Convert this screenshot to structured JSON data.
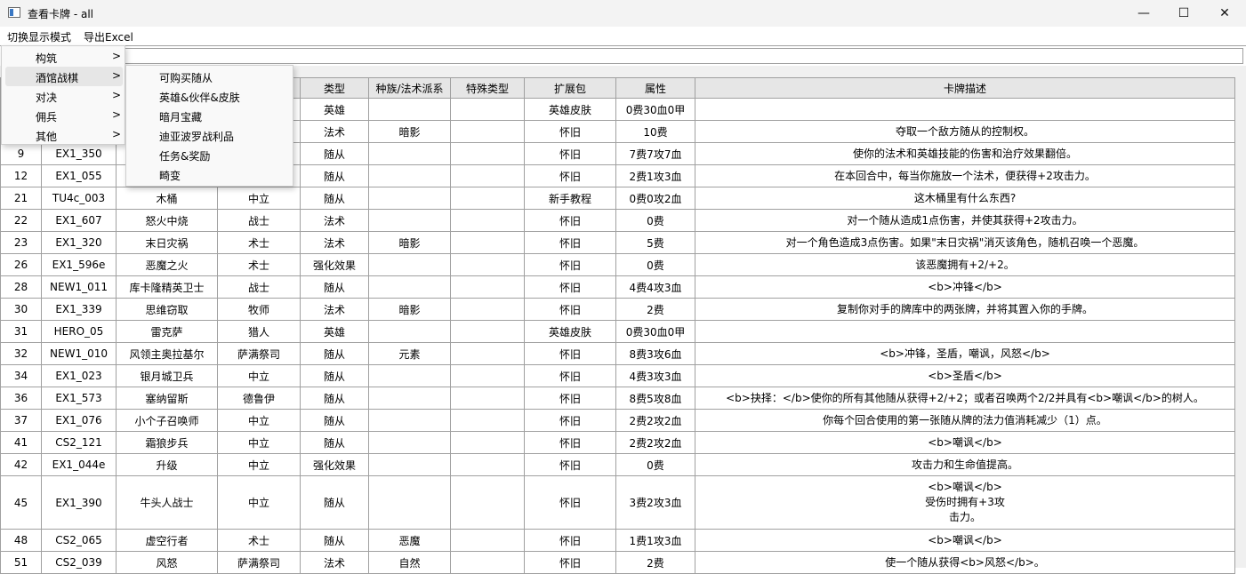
{
  "window": {
    "title": "查看卡牌 - all",
    "controls": {
      "minimize": "—",
      "maximize": "☐",
      "close": "✕"
    }
  },
  "menubar": [
    "切换显示模式",
    "导出Excel"
  ],
  "filter": {
    "value": "",
    "placeholder": ""
  },
  "menu": {
    "items": [
      {
        "label": "构筑",
        "arrow": ">"
      },
      {
        "label": "酒馆战棋",
        "arrow": ">"
      },
      {
        "label": "对决",
        "arrow": ">"
      },
      {
        "label": "佣兵",
        "arrow": ">"
      },
      {
        "label": "其他",
        "arrow": ">"
      }
    ],
    "active_index": 1,
    "submenu": [
      "可购买随从",
      "英雄&伙伴&皮肤",
      "暗月宝藏",
      "迪亚波罗战利品",
      "任务&奖励",
      "畸变"
    ]
  },
  "table": {
    "columns": [
      "",
      "",
      "",
      "",
      "类型",
      "种族/法术派系",
      "特殊类型",
      "扩展包",
      "属性",
      "卡牌描述"
    ],
    "rows": [
      [
        "",
        "",
        "",
        "",
        "英雄",
        "",
        "",
        "英雄皮肤",
        "0费30血0甲",
        ""
      ],
      [
        "",
        "",
        "",
        "",
        "法术",
        "暗影",
        "",
        "怀旧",
        "10费",
        "夺取一个敌方随从的控制权。"
      ],
      [
        "9",
        "EX1_350",
        "",
        "",
        "随从",
        "",
        "",
        "怀旧",
        "7费7攻7血",
        "使你的法术和英雄技能的伤害和治疗效果翻倍。"
      ],
      [
        "12",
        "EX1_055",
        "",
        "",
        "随从",
        "",
        "",
        "怀旧",
        "2费1攻3血",
        "在本回合中，每当你施放一个法术，便获得+2攻击力。"
      ],
      [
        "21",
        "TU4c_003",
        "木桶",
        "中立",
        "随从",
        "",
        "",
        "新手教程",
        "0费0攻2血",
        "这木桶里有什么东西?"
      ],
      [
        "22",
        "EX1_607",
        "怒火中烧",
        "战士",
        "法术",
        "",
        "",
        "怀旧",
        "0费",
        "对一个随从造成1点伤害，并使其获得+2攻击力。"
      ],
      [
        "23",
        "EX1_320",
        "末日灾祸",
        "术士",
        "法术",
        "暗影",
        "",
        "怀旧",
        "5费",
        "对一个角色造成3点伤害。如果\"末日灾祸\"消灭该角色，随机召唤一个恶魔。"
      ],
      [
        "26",
        "EX1_596e",
        "恶魔之火",
        "术士",
        "强化效果",
        "",
        "",
        "怀旧",
        "0费",
        "该恶魔拥有+2/+2。"
      ],
      [
        "28",
        "NEW1_011",
        "库卡隆精英卫士",
        "战士",
        "随从",
        "",
        "",
        "怀旧",
        "4费4攻3血",
        "<b>冲锋</b>"
      ],
      [
        "30",
        "EX1_339",
        "思维窃取",
        "牧师",
        "法术",
        "暗影",
        "",
        "怀旧",
        "2费",
        "复制你对手的牌库中的两张牌，并将其置入你的手牌。"
      ],
      [
        "31",
        "HERO_05",
        "雷克萨",
        "猎人",
        "英雄",
        "",
        "",
        "英雄皮肤",
        "0费30血0甲",
        ""
      ],
      [
        "32",
        "NEW1_010",
        "风领主奥拉基尔",
        "萨满祭司",
        "随从",
        "元素",
        "",
        "怀旧",
        "8费3攻6血",
        "<b>冲锋，圣盾，嘲讽，风怒</b>"
      ],
      [
        "34",
        "EX1_023",
        "银月城卫兵",
        "中立",
        "随从",
        "",
        "",
        "怀旧",
        "4费3攻3血",
        "<b>圣盾</b>"
      ],
      [
        "36",
        "EX1_573",
        "塞纳留斯",
        "德鲁伊",
        "随从",
        "",
        "",
        "怀旧",
        "8费5攻8血",
        "<b>抉择：</b>使你的所有其他随从获得+2/+2；或者召唤两个2/2并具有<b>嘲讽</b>的树人。"
      ],
      [
        "37",
        "EX1_076",
        "小个子召唤师",
        "中立",
        "随从",
        "",
        "",
        "怀旧",
        "2费2攻2血",
        "你每个回合使用的第一张随从牌的法力值消耗减少（1）点。"
      ],
      [
        "41",
        "CS2_121",
        "霜狼步兵",
        "中立",
        "随从",
        "",
        "",
        "怀旧",
        "2费2攻2血",
        "<b>嘲讽</b>"
      ],
      [
        "42",
        "EX1_044e",
        "升级",
        "中立",
        "强化效果",
        "",
        "",
        "怀旧",
        "0费",
        "攻击力和生命值提高。"
      ],
      [
        "45",
        "EX1_390",
        "牛头人战士",
        "中立",
        "随从",
        "",
        "",
        "怀旧",
        "3费2攻3血",
        "<b>嘲讽</b>\n受伤时拥有+3攻\n击力。"
      ],
      [
        "48",
        "CS2_065",
        "虚空行者",
        "术士",
        "随从",
        "恶魔",
        "",
        "怀旧",
        "1费1攻3血",
        "<b>嘲讽</b>"
      ],
      [
        "51",
        "CS2_039",
        "风怒",
        "萨满祭司",
        "法术",
        "自然",
        "",
        "怀旧",
        "2费",
        "使一个随从获得<b>风怒</b>。"
      ]
    ]
  }
}
